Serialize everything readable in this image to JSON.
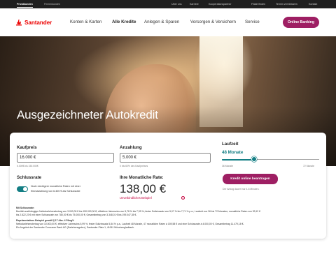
{
  "topbar": {
    "tabs": [
      "Privatkunden",
      "Firmenkunden"
    ],
    "links": [
      "Über uns",
      "Karriere",
      "Kooperationspartner",
      "Filiale finden",
      "Termin vereinbaren",
      "Kontakt"
    ]
  },
  "nav": {
    "brand": "Santander",
    "items": [
      "Konten & Karten",
      "Alle Kredite",
      "Anlegen & Sparen",
      "Vorsorgen & Versichern",
      "Service"
    ],
    "online_banking": "Online Banking"
  },
  "hero": {
    "title": "Ausgezeichneter Autokredit"
  },
  "calc": {
    "kaufpreis": {
      "label": "Kaufpreis",
      "value": "16.000 €",
      "hint": "5.000€ bis 150.000€"
    },
    "anzahlung": {
      "label": "Anzahlung",
      "value": "5.000 €",
      "hint": "0 bis 60% des Kaufpreises"
    },
    "laufzeit": {
      "label": "Laufzeit",
      "value": "48 Monate",
      "min_label": "36 Monate",
      "max_label": "72 Monate",
      "min": 36,
      "max": 72,
      "current": 48
    },
    "schlussrate": {
      "label": "Schlussrate",
      "text_line1": "Noch niedrigere monatliche Raten mit einer",
      "text_line2": "Einmalzahlung von 6.400 € als Schlussrate"
    },
    "rate": {
      "label": "Ihre Monatliche Rate:",
      "value": "138,00 €",
      "link": "Unverbindliches Beispiel"
    },
    "apply_button": "Kredit online beantragen",
    "apply_note": "Der Antrag dauert nur 4-8 Minuten."
  },
  "footnote": {
    "heading1": "Mit Schlussrate:",
    "line1": "Bonität unabhängiger Nettodarlehensbetrag von 3.000,00 € bis 150.000,00 €; effektiver Jahreszins von 5,78 % bis 7,99 %; fester Sollzinssatz von 5,07 % bis 7,71 % p.a.; Laufzeit von 36 bis 72 Monaten; monatliche Raten von 39,12 €",
    "line2": "bis 2.822,23 € mit einer Schlussrate von 780,00 € bis 75.000,00 €; Gesamtbetrag von 3.348,01 € bis 199.047,35 €.",
    "heading2": "Repräsentatives Beispiel gemäß § 17 Abs. 4 PAngV:",
    "line3": "Nettodarlehensbetrag von 10.000,00 €, effektiver Jahreszins 5,99 %, fester Sollzinssatz 5,84 % p.a., Laufzeit 48 Monate, 47 monatliche Raten à 159,58 € und eine Schlussrate à 4.000,00 €, Gesamtbetrag 11.479,18 €.",
    "line4": "Ein Angebot der Santander Consumer Bank AG (Darlehensgeber), Santander-Platz 1, 41061 Mönchengladbach."
  }
}
